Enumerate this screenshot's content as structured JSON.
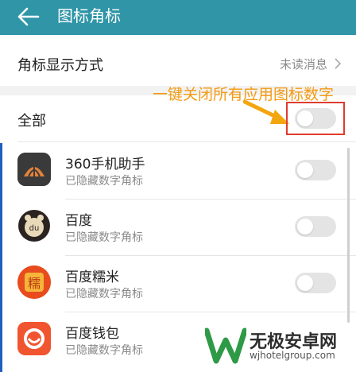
{
  "header": {
    "title": "图标角标",
    "back_icon": "back-arrow-icon"
  },
  "display_row": {
    "label": "角标显示方式",
    "value": "未读消息"
  },
  "all_row": {
    "label": "全部",
    "toggle_on": false
  },
  "annotation": {
    "text": "一键关闭所有应用图标数字",
    "color": "#f39a12"
  },
  "apps": [
    {
      "name": "360手机助手",
      "status": "已隐藏数字角标",
      "toggle_on": false,
      "icon": "360-assistant-icon"
    },
    {
      "name": "百度",
      "status": "已隐藏数字角标",
      "toggle_on": false,
      "icon": "baidu-icon"
    },
    {
      "name": "百度糯米",
      "status": "已隐藏数字角标",
      "toggle_on": false,
      "icon": "baidu-nuomi-icon",
      "icon_glyph": "糯"
    },
    {
      "name": "百度钱包",
      "status": "已隐藏数字角标",
      "toggle_on": false,
      "icon": "baidu-wallet-icon"
    }
  ],
  "watermark": {
    "text": "无极安卓网",
    "url": "wjhotelgroup.com",
    "logo": "w-logo-icon"
  },
  "colors": {
    "header": "#2f95a7",
    "toggle_off": "#e4e4e4",
    "highlight_box": "#e03b2e"
  }
}
